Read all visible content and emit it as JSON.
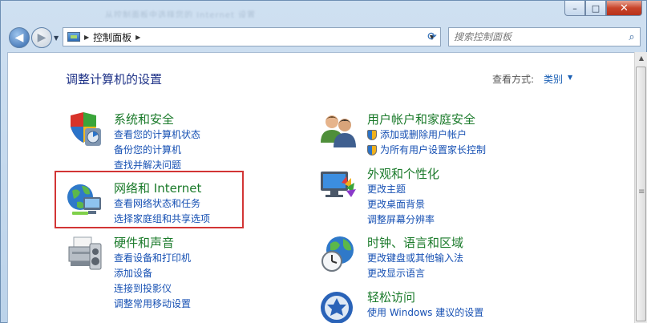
{
  "window": {
    "blurred_title": "从控制面板中选择您的 Internet 设置",
    "minimize": "–",
    "maximize": "□",
    "close": "✕"
  },
  "address": {
    "breadcrumb": "控制面板",
    "search_placeholder": "搜索控制面板"
  },
  "header": {
    "title": "调整计算机的设置",
    "view_label": "查看方式:",
    "view_value": "类别"
  },
  "categories": [
    {
      "icon": "shield-icon",
      "title": "系统和安全",
      "links": [
        "查看您的计算机状态",
        "备份您的计算机",
        "查找并解决问题"
      ]
    },
    {
      "icon": "network-icon",
      "title": "网络和 Internet",
      "links": [
        "查看网络状态和任务",
        "选择家庭组和共享选项"
      ]
    },
    {
      "icon": "printer-icon",
      "title": "硬件和声音",
      "links": [
        "查看设备和打印机",
        "添加设备",
        "连接到投影仪",
        "调整常用移动设置"
      ]
    },
    {
      "icon": "users-icon",
      "title": "用户帐户和家庭安全",
      "links": [
        "添加或删除用户帐户",
        "为所有用户设置家长控制"
      ]
    },
    {
      "icon": "display-icon",
      "title": "外观和个性化",
      "links": [
        "更改主题",
        "更改桌面背景",
        "调整屏幕分辨率"
      ]
    },
    {
      "icon": "globe-clock-icon",
      "title": "时钟、语言和区域",
      "links": [
        "更改键盘或其他输入法",
        "更改显示语言"
      ]
    },
    {
      "icon": "ease-access-icon",
      "title": "轻松访问",
      "links": [
        "使用 Windows 建议的设置"
      ]
    }
  ],
  "colors": {
    "title_green": "#1a7a2a",
    "link_blue": "#1650b3",
    "highlight_red": "#d23535"
  }
}
